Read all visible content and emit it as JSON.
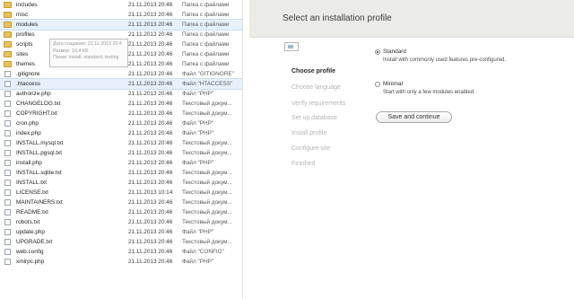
{
  "explorer": {
    "rows": [
      {
        "name": "includes",
        "date": "21.11.2013 20:46",
        "type": "Папка с файлами",
        "icon": "folder-icon"
      },
      {
        "name": "misc",
        "date": "21.11.2013 20:46",
        "type": "Папка с файлами",
        "icon": "folder-icon"
      },
      {
        "name": "modules",
        "date": "21.11.2013 20:46",
        "type": "Папка с файлами",
        "icon": "folder-icon",
        "highlighted": true
      },
      {
        "name": "profiles",
        "date": "21.11.2013 20:46",
        "type": "Папка с файлами",
        "icon": "folder-icon"
      },
      {
        "name": "scripts",
        "date": "21.11.2013 20:46",
        "type": "Папка с файлами",
        "icon": "folder-icon"
      },
      {
        "name": "sites",
        "date": "21.11.2013 20:46",
        "type": "Папка с файлами",
        "icon": "folder-icon"
      },
      {
        "name": "themes",
        "date": "21.11.2013 20:46",
        "type": "Папка с файлами",
        "icon": "folder-icon"
      },
      {
        "name": ".gitignore",
        "date": "21.11.2013 20:46",
        "type": "Файл \"GITIGNORE\"",
        "icon": "file-icon"
      },
      {
        "name": ".htaccess",
        "date": "21.11.2013 20:46",
        "type": "Файл \"HTACCESS\"",
        "icon": "file-icon",
        "highlighted": true
      },
      {
        "name": "authorize.php",
        "date": "21.11.2013 20:46",
        "type": "Файл \"PHP\"",
        "icon": "file-icon"
      },
      {
        "name": "CHANGELOG.txt",
        "date": "21.11.2013 20:46",
        "type": "Текстовый докум...",
        "icon": "file-icon"
      },
      {
        "name": "COPYRIGHT.txt",
        "date": "21.11.2013 20:46",
        "type": "Текстовый докум...",
        "icon": "file-icon"
      },
      {
        "name": "cron.php",
        "date": "21.11.2013 20:46",
        "type": "Файл \"PHP\"",
        "icon": "file-icon"
      },
      {
        "name": "index.php",
        "date": "21.11.2013 20:46",
        "type": "Файл \"PHP\"",
        "icon": "file-icon"
      },
      {
        "name": "INSTALL.mysql.txt",
        "date": "21.11.2013 20:46",
        "type": "Текстовый докум...",
        "icon": "file-icon"
      },
      {
        "name": "INSTALL.pgsql.txt",
        "date": "21.11.2013 20:46",
        "type": "Текстовый докум...",
        "icon": "file-icon"
      },
      {
        "name": "install.php",
        "date": "21.11.2013 20:46",
        "type": "Файл \"PHP\"",
        "icon": "file-icon"
      },
      {
        "name": "INSTALL.sqlite.txt",
        "date": "21.11.2013 20:46",
        "type": "Текстовый докум...",
        "icon": "file-icon"
      },
      {
        "name": "INSTALL.txt",
        "date": "21.11.2013 20:46",
        "type": "Текстовый докум...",
        "icon": "file-icon"
      },
      {
        "name": "LICENSE.txt",
        "date": "21.11.2013 10:14",
        "type": "Текстовый докум...",
        "icon": "file-icon"
      },
      {
        "name": "MAINTAINERS.txt",
        "date": "21.11.2013 20:46",
        "type": "Текстовый докум...",
        "icon": "file-icon"
      },
      {
        "name": "README.txt",
        "date": "21.11.2013 20:46",
        "type": "Текстовый докум...",
        "icon": "file-icon"
      },
      {
        "name": "robots.txt",
        "date": "21.11.2013 20:46",
        "type": "Текстовый докум...",
        "icon": "file-icon"
      },
      {
        "name": "update.php",
        "date": "21.11.2013 20:46",
        "type": "Файл \"PHP\"",
        "icon": "file-icon"
      },
      {
        "name": "UPGRADE.txt",
        "date": "21.11.2013 20:46",
        "type": "Текстовый докум...",
        "icon": "file-icon"
      },
      {
        "name": "web.config",
        "date": "21.11.2013 20:46",
        "type": "Файл \"CONFIG\"",
        "icon": "file-icon"
      },
      {
        "name": "xmlrpc.php",
        "date": "21.11.2013 20:46",
        "type": "Файл \"PHP\"",
        "icon": "file-icon"
      }
    ],
    "tooltip": {
      "line1": "Дата создания: 21.11.2013 20:4",
      "line2": "Размер: 16,4 КБ",
      "line3": "Папки: install, standard, testing"
    }
  },
  "installer": {
    "title": "Select an installation profile",
    "logo_icon": "broken-image-icon",
    "steps": [
      {
        "label": "Choose profile",
        "active": true
      },
      {
        "label": "Choose language",
        "active": false
      },
      {
        "label": "Verify requirements",
        "active": false
      },
      {
        "label": "Set up database",
        "active": false
      },
      {
        "label": "Install profile",
        "active": false
      },
      {
        "label": "Configure site",
        "active": false
      },
      {
        "label": "Finished",
        "active": false
      }
    ],
    "profiles": [
      {
        "label": "Standard",
        "description": "Install with commonly used features pre-configured.",
        "selected": true
      },
      {
        "label": "Minimal",
        "description": "Start with only a few modules enabled.",
        "selected": false
      }
    ],
    "save_label": "Save and continue"
  },
  "colors": {
    "header_bg": "#ebebe8",
    "folder": "#e9c25b",
    "highlight": "#e8f1fb"
  }
}
